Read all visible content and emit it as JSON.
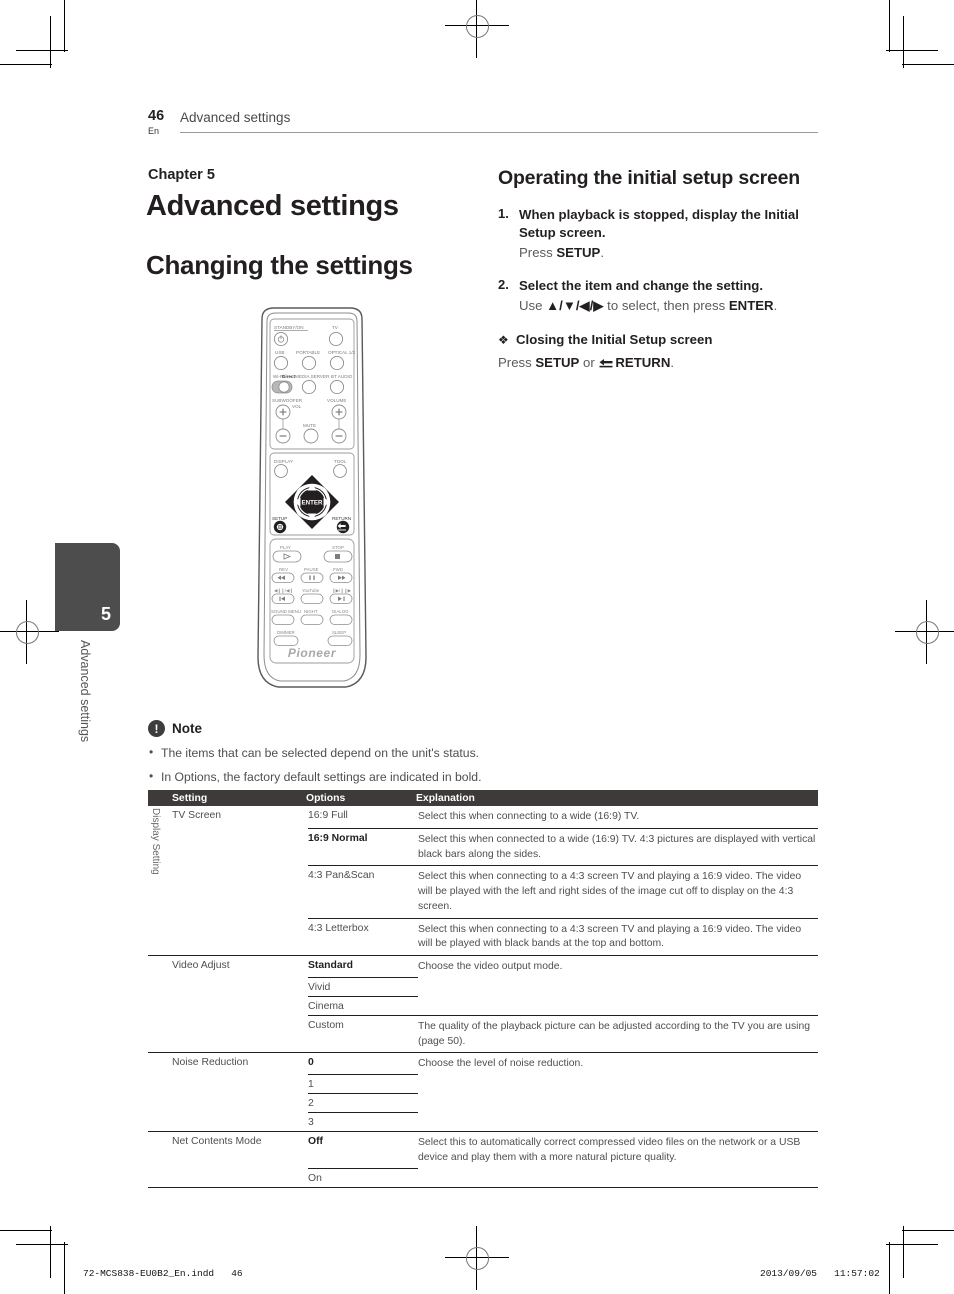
{
  "header": {
    "page_number": "46",
    "lang": "En",
    "title": "Advanced settings"
  },
  "side_tab": {
    "number": "5",
    "label": "Advanced settings"
  },
  "left_column": {
    "chapter_label": "Chapter 5",
    "chapter_title": "Advanced settings",
    "section_title": "Changing the settings"
  },
  "right_column": {
    "heading": "Operating the initial setup screen",
    "steps": [
      {
        "number": "1.",
        "bold": "When playback is stopped, display the Initial Setup screen.",
        "sub_prefix": "Press ",
        "sub_key": "SETUP",
        "sub_suffix": "."
      },
      {
        "number": "2.",
        "bold": "Select the item and change the setting.",
        "sub_prefix": "Use ",
        "sub_key": "▲/▼/◀/▶",
        "sub_mid": " to select, then press ",
        "sub_key2": "ENTER",
        "sub_suffix": "."
      }
    ],
    "closing": {
      "bullet": "❖",
      "title": "Closing the Initial Setup screen",
      "press_prefix": "Press ",
      "press_key": "SETUP",
      "press_or": " or ",
      "press_key2": "RETURN",
      "press_suffix": "."
    }
  },
  "remote": {
    "brand": "Pioneer",
    "labels": {
      "standby": "STANDBY/ON",
      "tv": "TV",
      "usb": "USB",
      "portable": "PORTABLE",
      "optical": "OPTICAL 1/2",
      "wifi_direct": "Wi-Fi Direct",
      "media_server": "MEDIA SERVER",
      "bt_audio": "BT AUDIO",
      "subwoofer": "SUBWOOFER",
      "vol": "VOL",
      "volume": "VOLUME",
      "mute": "MUTE",
      "display": "DISPLAY",
      "tool": "TOOL",
      "enter": "ENTER",
      "setup": "SETUP",
      "return": "RETURN",
      "play": "PLAY",
      "stop": "STOP",
      "rev": "REV",
      "pause": "PAUSE",
      "fwd": "FWD",
      "prev_step": "◀❙❙/◀❙",
      "youtube": "YouTube",
      "next_step": "❙▶/❙❙▶",
      "sound_menu": "SOUND MENU",
      "night": "NIGHT",
      "dialog": "DIALOG",
      "dimmer": "DIMMER",
      "sleep": "SLEEP"
    }
  },
  "note": {
    "icon": "!",
    "label": "Note",
    "items": [
      "The items that can be selected depend on the unit's status.",
      "In Options, the factory default settings are indicated in bold."
    ]
  },
  "table": {
    "columns": [
      "",
      "Setting",
      "Options",
      "Explanation"
    ],
    "group_label": "Display Setting",
    "rows": [
      {
        "setting": "TV Screen",
        "options": [
          {
            "label": "16:9 Full",
            "bold": false,
            "explanation": "Select this when connecting to a wide (16:9) TV."
          },
          {
            "label": "16:9 Normal",
            "bold": true,
            "explanation": "Select this when connected to a wide (16:9) TV. 4:3 pictures are displayed with vertical black bars along the sides."
          },
          {
            "label": "4:3 Pan&Scan",
            "bold": false,
            "explanation": "Select this when connecting to a 4:3 screen TV and playing a 16:9 video. The video will be played with the left and right sides of the image cut off to display on the 4:3 screen."
          },
          {
            "label": "4:3 Letterbox",
            "bold": false,
            "explanation": "Select this when connecting to a 4:3 screen TV and playing a 16:9 video. The video will be played with black bands at the top and bottom."
          }
        ]
      },
      {
        "setting": "Video Adjust",
        "options": [
          {
            "label": "Standard",
            "bold": true,
            "explanation": "Choose the video output mode."
          },
          {
            "label": "Vivid",
            "bold": false,
            "explanation": ""
          },
          {
            "label": "Cinema",
            "bold": false,
            "explanation": ""
          },
          {
            "label": "Custom",
            "bold": false,
            "explanation": "The quality of the playback picture can be adjusted according to the TV you are using (page 50)."
          }
        ]
      },
      {
        "setting": "Noise Reduction",
        "options": [
          {
            "label": "0",
            "bold": true,
            "explanation": "Choose the level of noise reduction."
          },
          {
            "label": "1",
            "bold": false,
            "explanation": ""
          },
          {
            "label": "2",
            "bold": false,
            "explanation": ""
          },
          {
            "label": "3",
            "bold": false,
            "explanation": ""
          }
        ]
      },
      {
        "setting": "Net Contents Mode",
        "options": [
          {
            "label": "Off",
            "bold": true,
            "explanation": "Select this to automatically correct compressed video files on the network or a USB device and play them with a more natural picture quality."
          },
          {
            "label": "On",
            "bold": false,
            "explanation": ""
          }
        ]
      }
    ]
  },
  "footer": {
    "left": "72-MCS838-EU0B2_En.indd   46",
    "right": "2013/09/05   11:57:02"
  }
}
